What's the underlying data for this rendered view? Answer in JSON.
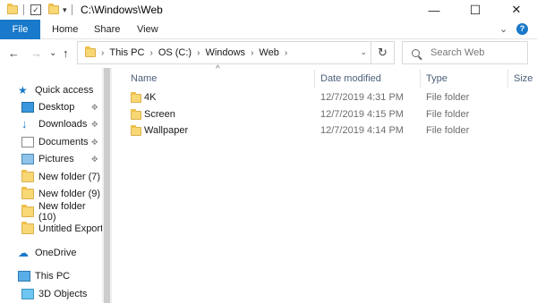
{
  "window": {
    "title": "C:\\Windows\\Web",
    "minimize_glyph": "—",
    "maximize_glyph": "☐",
    "close_glyph": "✕"
  },
  "quick_access_toolbar": {
    "dropdown_glyph": "▾"
  },
  "ribbon": {
    "tabs": [
      {
        "label": "File",
        "active": true
      },
      {
        "label": "Home"
      },
      {
        "label": "Share"
      },
      {
        "label": "View"
      }
    ],
    "expand_glyph": "⌄",
    "help_glyph": "?"
  },
  "navigation": {
    "back_glyph": "←",
    "forward_glyph": "→",
    "dropdown_glyph": "⌄",
    "up_glyph": "↑",
    "refresh_glyph": "↻"
  },
  "address": {
    "crumbs": [
      "This PC",
      "OS (C:)",
      "Windows",
      "Web"
    ],
    "separator": "›",
    "trailing_separator": "›",
    "dropdown_glyph": "⌄"
  },
  "search": {
    "placeholder": "Search Web"
  },
  "nav_pane": {
    "items": [
      {
        "label": "Quick access",
        "icon": "star-icon",
        "pinned": false
      },
      {
        "label": "Desktop",
        "icon": "desktop-icon",
        "pinned": true
      },
      {
        "label": "Downloads",
        "icon": "download-icon",
        "pinned": true
      },
      {
        "label": "Documents",
        "icon": "documents-icon",
        "pinned": true
      },
      {
        "label": "Pictures",
        "icon": "pictures-icon",
        "pinned": true
      },
      {
        "label": "New folder (7)",
        "icon": "folder-icon",
        "pinned": false
      },
      {
        "label": "New folder (9)",
        "icon": "folder-icon",
        "pinned": false
      },
      {
        "label": "New folder (10)",
        "icon": "folder-icon",
        "pinned": false
      },
      {
        "label": "Untitled Export",
        "icon": "folder-icon",
        "pinned": false
      },
      {
        "label": "OneDrive",
        "icon": "cloud-icon",
        "pinned": false
      },
      {
        "label": "This PC",
        "icon": "computer-icon",
        "pinned": false
      },
      {
        "label": "3D Objects",
        "icon": "cube-icon",
        "pinned": false
      }
    ],
    "pin_glyph": "📌"
  },
  "file_list": {
    "sort_caret": "^",
    "columns": {
      "name": "Name",
      "date": "Date modified",
      "type": "Type",
      "size": "Size"
    },
    "rows": [
      {
        "name": "4K",
        "date": "12/7/2019 4:31 PM",
        "type": "File folder"
      },
      {
        "name": "Screen",
        "date": "12/7/2019 4:15 PM",
        "type": "File folder"
      },
      {
        "name": "Wallpaper",
        "date": "12/7/2019 4:14 PM",
        "type": "File folder"
      }
    ]
  },
  "colors": {
    "accent": "#1979ca",
    "folder": "#f8d775",
    "column_header": "#4c607a",
    "secondary_text": "#6d6d6d"
  }
}
